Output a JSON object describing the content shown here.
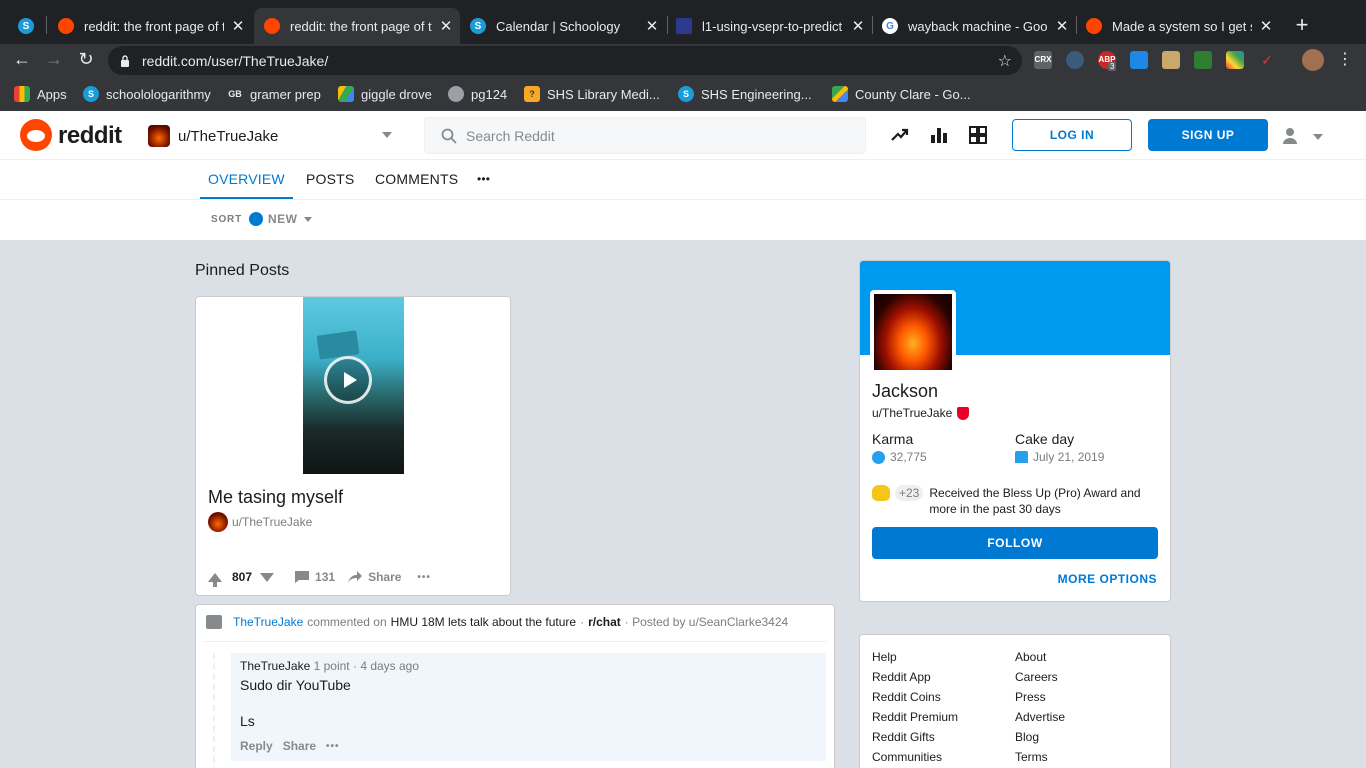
{
  "browser": {
    "tabs": [
      {
        "title": "",
        "favicon": "schoology-icon",
        "x": 0
      },
      {
        "title": "reddit: the front page of the",
        "favicon": "reddit-icon"
      },
      {
        "title": "reddit: the front page of the",
        "favicon": "reddit-icon"
      },
      {
        "title": "Calendar | Schoology",
        "favicon": "schoology-icon"
      },
      {
        "title": "l1-using-vsepr-to-predict",
        "favicon": "school-crest-icon"
      },
      {
        "title": "wayback machine - Google",
        "favicon": "google-icon"
      },
      {
        "title": "Made a system so I get s",
        "favicon": "reddit-icon"
      }
    ],
    "url": "reddit.com/user/TheTrueJake/",
    "bookmarks": [
      "Apps",
      "schoolologarithmy",
      "gramer prep",
      "giggle drove",
      "pg124",
      "SHS Library Medi...",
      "SHS Engineering...",
      "County Clare - Go..."
    ],
    "extensions": {
      "crx": "CRX",
      "abp": "ABP",
      "abp_count": "3"
    }
  },
  "header": {
    "wordmark": "reddit",
    "user": "u/TheTrueJake",
    "search_placeholder": "Search Reddit",
    "login": "LOG IN",
    "signup": "SIGN UP"
  },
  "profile_tabs": [
    "OVERVIEW",
    "POSTS",
    "COMMENTS",
    "•••"
  ],
  "sort": {
    "label": "SORT",
    "value": "NEW"
  },
  "pinned": {
    "section_title": "Pinned Posts",
    "post_title": "Me tasing myself",
    "author": "u/TheTrueJake",
    "score": "807",
    "comments": "131",
    "share": "Share",
    "more": "•••"
  },
  "comment_card": {
    "user": "TheTrueJake",
    "commented_on": "commented on",
    "post_title": "HMU 18M lets talk about the future",
    "subreddit": "r/chat",
    "posted_by": "· Posted by u/SeanClarke3424",
    "comment": {
      "author": "TheTrueJake",
      "points": "1 point",
      "age": "· 4 days ago",
      "line1": "Sudo dir YouTube",
      "line2": "Ls",
      "reply": "Reply",
      "share": "Share",
      "more": "•••"
    }
  },
  "sidebar": {
    "display_name": "Jackson",
    "username": "u/TheTrueJake",
    "karma_label": "Karma",
    "karma_value": "32,775",
    "cakeday_label": "Cake day",
    "cakeday_value": "July 21, 2019",
    "award_count": "+23",
    "award_text": "Received the Bless Up (Pro) Award and more in the past 30 days",
    "follow": "FOLLOW",
    "more_options": "MORE OPTIONS",
    "links_left": [
      "Help",
      "Reddit App",
      "Reddit Coins",
      "Reddit Premium",
      "Reddit Gifts",
      "Communities"
    ],
    "links_right": [
      "About",
      "Careers",
      "Press",
      "Advertise",
      "Blog",
      "Terms"
    ]
  },
  "colors": {
    "reddit_orange": "#ff4500",
    "reddit_blue": "#0079d3",
    "banner": "#0099f0",
    "bg": "#dae0e6"
  }
}
